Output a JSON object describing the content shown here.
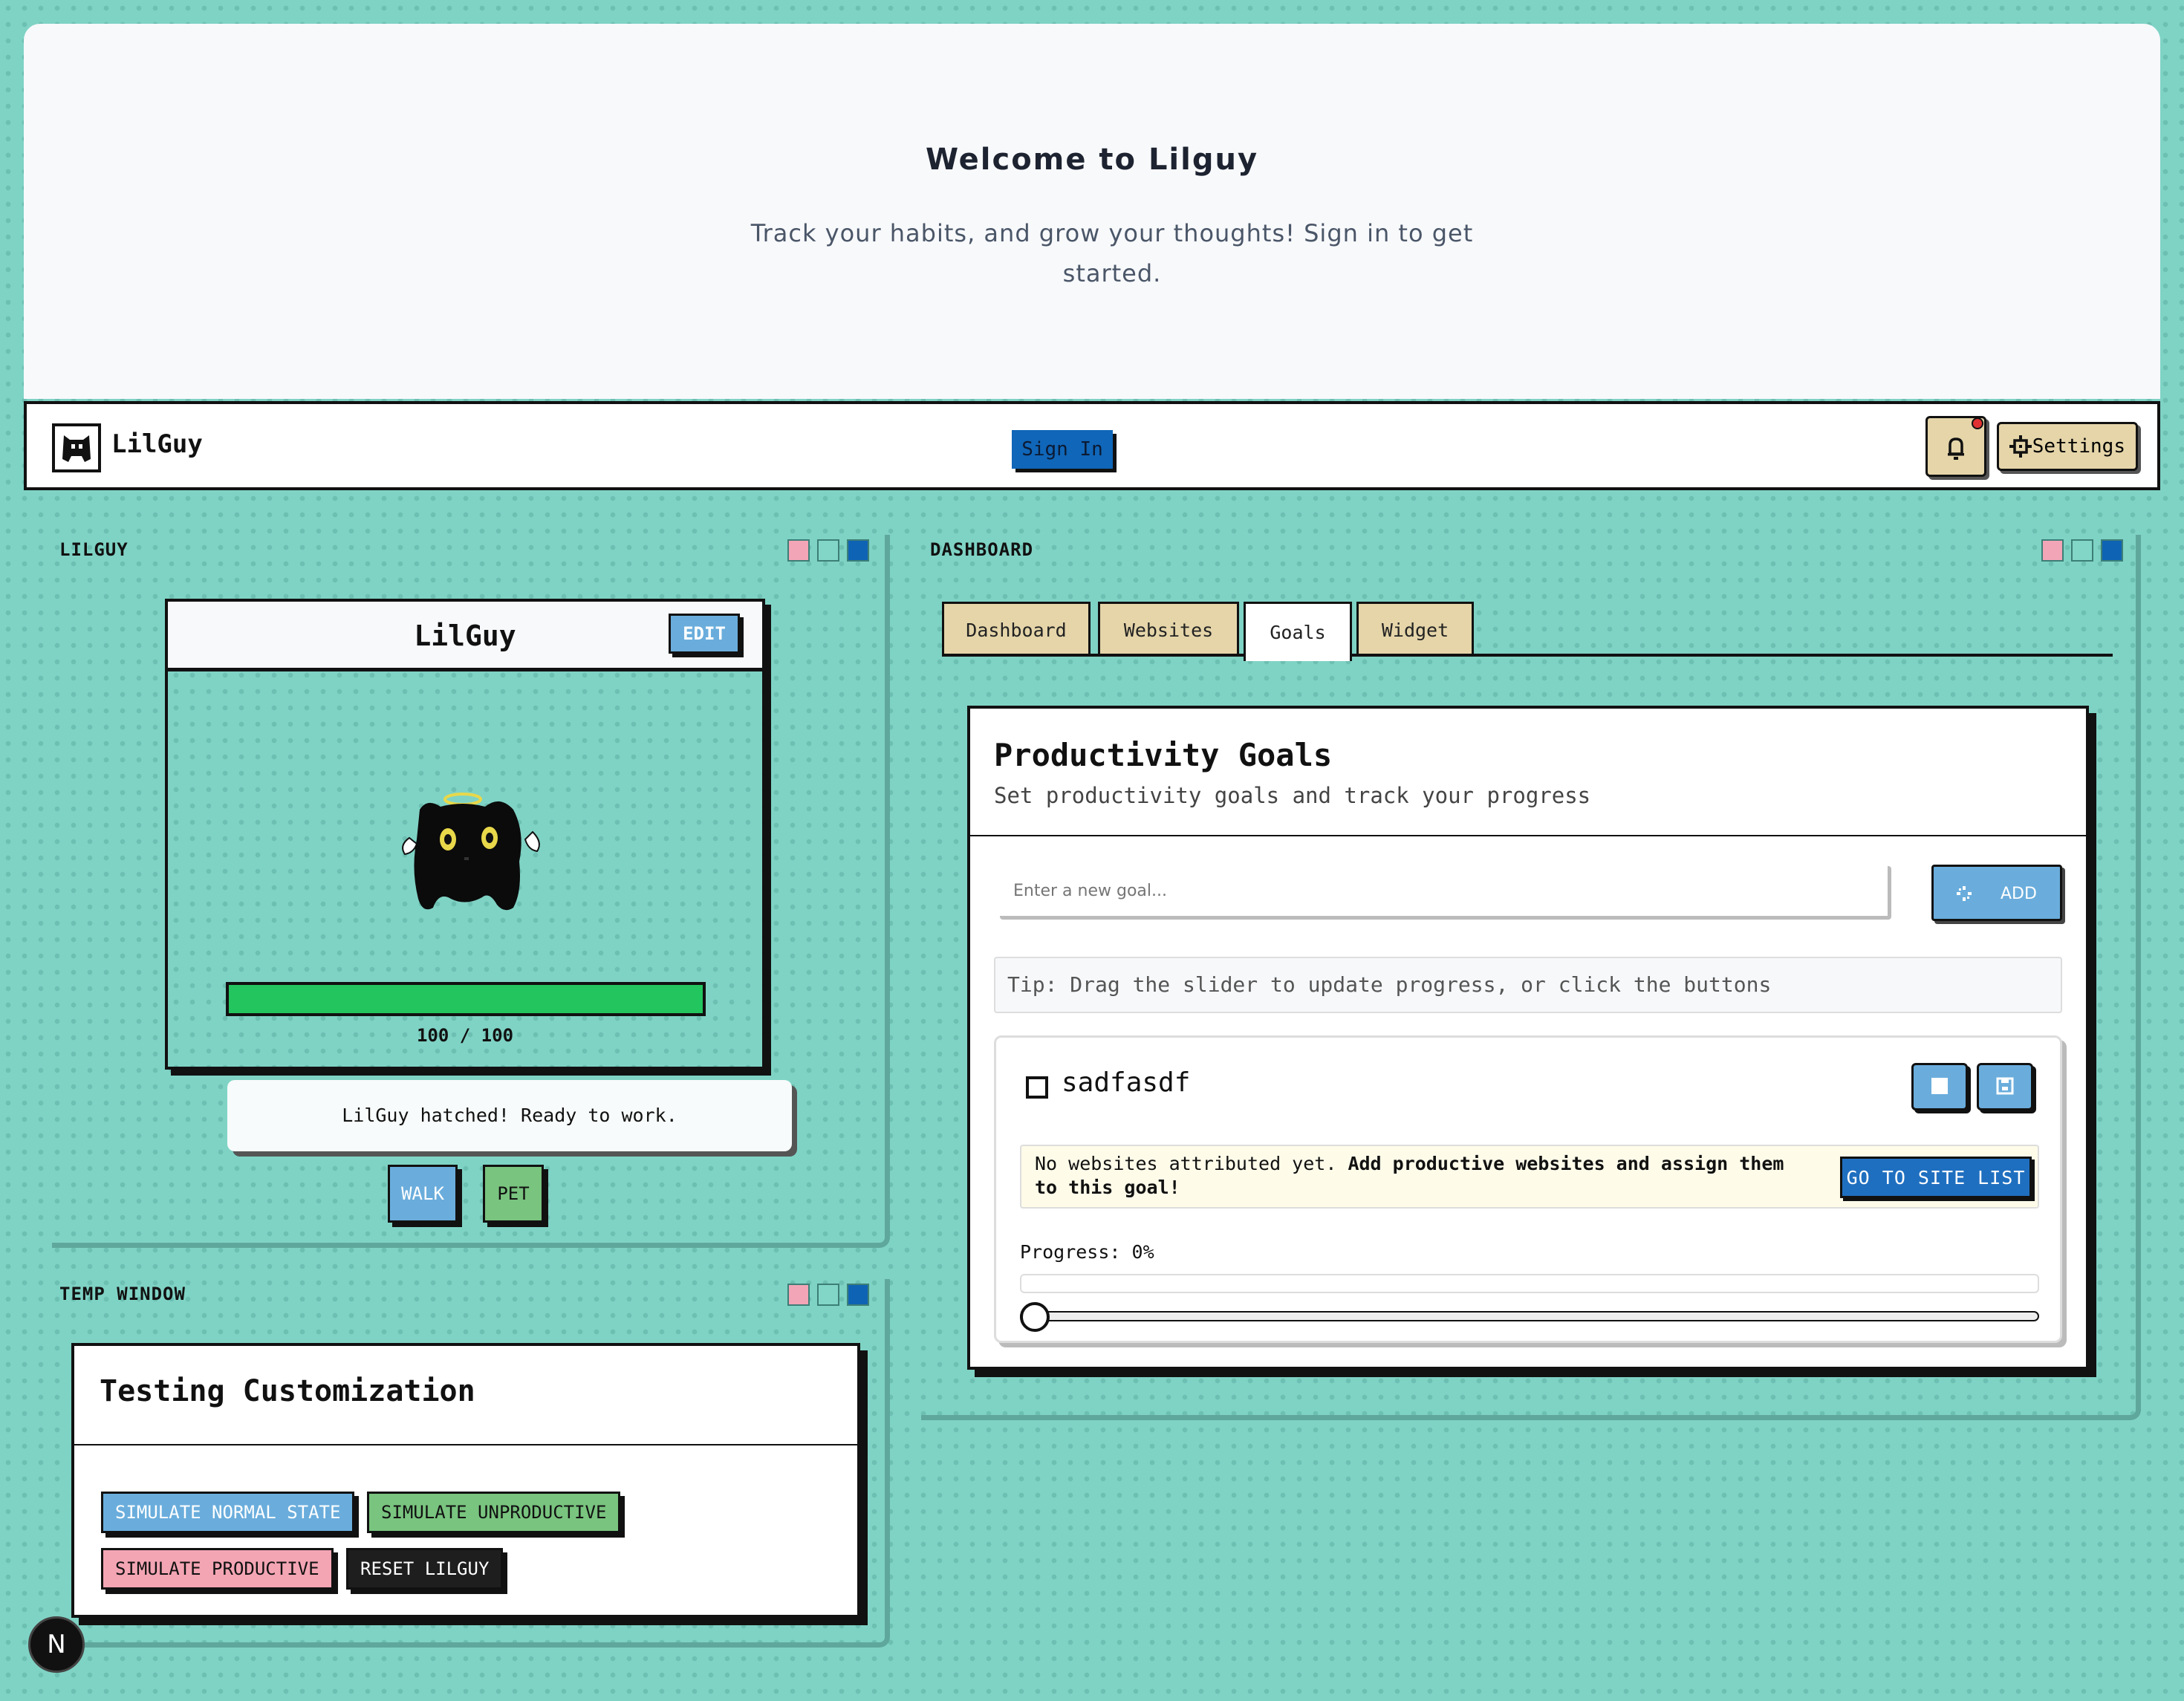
{
  "hero": {
    "title": "Welcome to Lilguy",
    "subtitle": "Track your habits, and grow your thoughts! Sign in to get started."
  },
  "navbar": {
    "app_name": "LilGuy",
    "sign_in_label": "Sign In",
    "settings_label": "Settings"
  },
  "lilguy_window": {
    "title": "LILGUY",
    "pet_name": "LilGuy",
    "edit_label": "EDIT",
    "health_text": "100 / 100",
    "health_fraction": 1.0,
    "status_message": "LilGuy hatched! Ready to work.",
    "walk_label": "WALK",
    "pet_label": "PET"
  },
  "temp_window": {
    "title": "TEMP WINDOW",
    "card_title": "Testing Customization",
    "buttons": [
      {
        "label": "SIMULATE NORMAL STATE",
        "color": "#6aaddc"
      },
      {
        "label": "SIMULATE UNPRODUCTIVE",
        "color": "#79c47f"
      },
      {
        "label": "SIMULATE PRODUCTIVE",
        "color": "#f3a5b4"
      },
      {
        "label": "RESET LILGUY",
        "color": "#1e1e1e"
      }
    ]
  },
  "dashboard_window": {
    "title": "DASHBOARD",
    "tabs": [
      {
        "label": "Dashboard",
        "active": false
      },
      {
        "label": "Websites",
        "active": false
      },
      {
        "label": "Goals",
        "active": true
      },
      {
        "label": "Widget",
        "active": false
      }
    ],
    "goals": {
      "title": "Productivity Goals",
      "subtitle": "Set productivity goals and track your progress",
      "input_placeholder": "Enter a new goal...",
      "add_label": "ADD",
      "tip": "Tip: Drag the slider to update progress, or click the buttons",
      "items": [
        {
          "name": "sadfasdf",
          "completed": false,
          "attribution_text": "No websites attributed yet.",
          "attribution_cta": "Add productive websites and assign them to this goal!",
          "go_to_sites_label": "GO TO SITE LIST",
          "progress_label": "Progress: 0%",
          "progress_value": 0
        }
      ]
    }
  },
  "footer_badge": "N",
  "colors": {
    "background": "#7fd3c5",
    "accent_blue": "#1066b8",
    "tab_tan": "#e5d5a9",
    "health_green": "#22c55e",
    "window_pink": "#f2a5b6",
    "window_teal": "#82d6c8",
    "window_blue": "#0f63b4"
  },
  "icons": {
    "logo": "lilguy-logo-icon",
    "bell": "bell-icon",
    "settings": "gear-icon",
    "add": "loader-icon",
    "stop": "stop-square-icon",
    "save": "save-icon"
  }
}
